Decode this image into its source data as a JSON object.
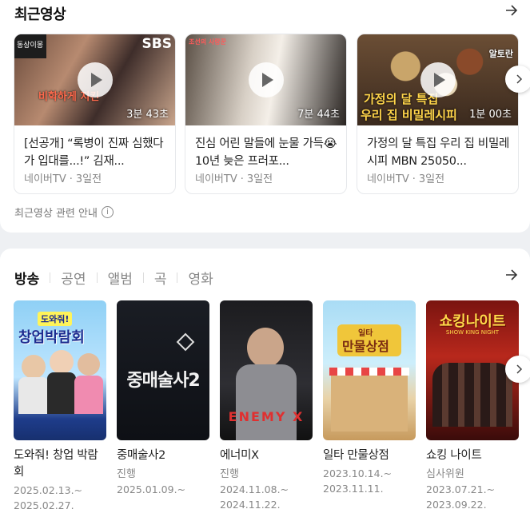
{
  "recent": {
    "title": "최근영상",
    "notice": "최근영상 관련 안내",
    "videos": [
      {
        "duration": "3분 43초",
        "title": "[선공개] “록병이 진짜 심했다가 입대를...!” 김재...",
        "source": "네이버TV",
        "age": "3일전",
        "overlay_logo": "SBS",
        "overlay_caption": "동상이몽",
        "overlay_text": "비학하게 지킨"
      },
      {
        "duration": "7분 44초",
        "title": "진심 어린 말들에 눈물 가득😭 10년 늦은 프러포...",
        "source": "네이버TV",
        "age": "3일전",
        "overlay_caption": "조선의 사랑꾼"
      },
      {
        "duration": "1분 00초",
        "title": "가정의 달 특집 우리 집 비밀레시피 MBN 25050...",
        "source": "네이버TV",
        "age": "3일전",
        "overlay_text": "가정의 달 특집",
        "overlay_text2": "우리 집 비밀레시피",
        "overlay_caption": "알토란"
      }
    ]
  },
  "broadcast": {
    "tabs": [
      "방송",
      "공연",
      "앨범",
      "곡",
      "영화"
    ],
    "items": [
      {
        "title": "도와줘! 창업 박람회",
        "status": "",
        "date_start": "2025.02.13.~",
        "date_end": "2025.02.27.",
        "poster_text": "창업박람회",
        "poster_sub": "도와줘!"
      },
      {
        "title": "중매술사2",
        "status": "진행",
        "date_start": "2025.01.09.~",
        "date_end": "",
        "poster_text": "중매술사2"
      },
      {
        "title": "에너미X",
        "status": "진행",
        "date_start": "2024.11.08.~",
        "date_end": "2024.11.22.",
        "poster_text": "ENEMY X"
      },
      {
        "title": "일타 만물상점",
        "status": "",
        "date_start": "2023.10.14.~",
        "date_end": "2023.11.11.",
        "poster_text": "만물상점",
        "poster_sub": "일타"
      },
      {
        "title": "쇼킹 나이트",
        "status": "심사위원",
        "date_start": "2023.07.21.~",
        "date_end": "2023.09.22.",
        "poster_text": "쇼킹나이트",
        "poster_sub": "SHOW KING NIGHT"
      }
    ]
  }
}
